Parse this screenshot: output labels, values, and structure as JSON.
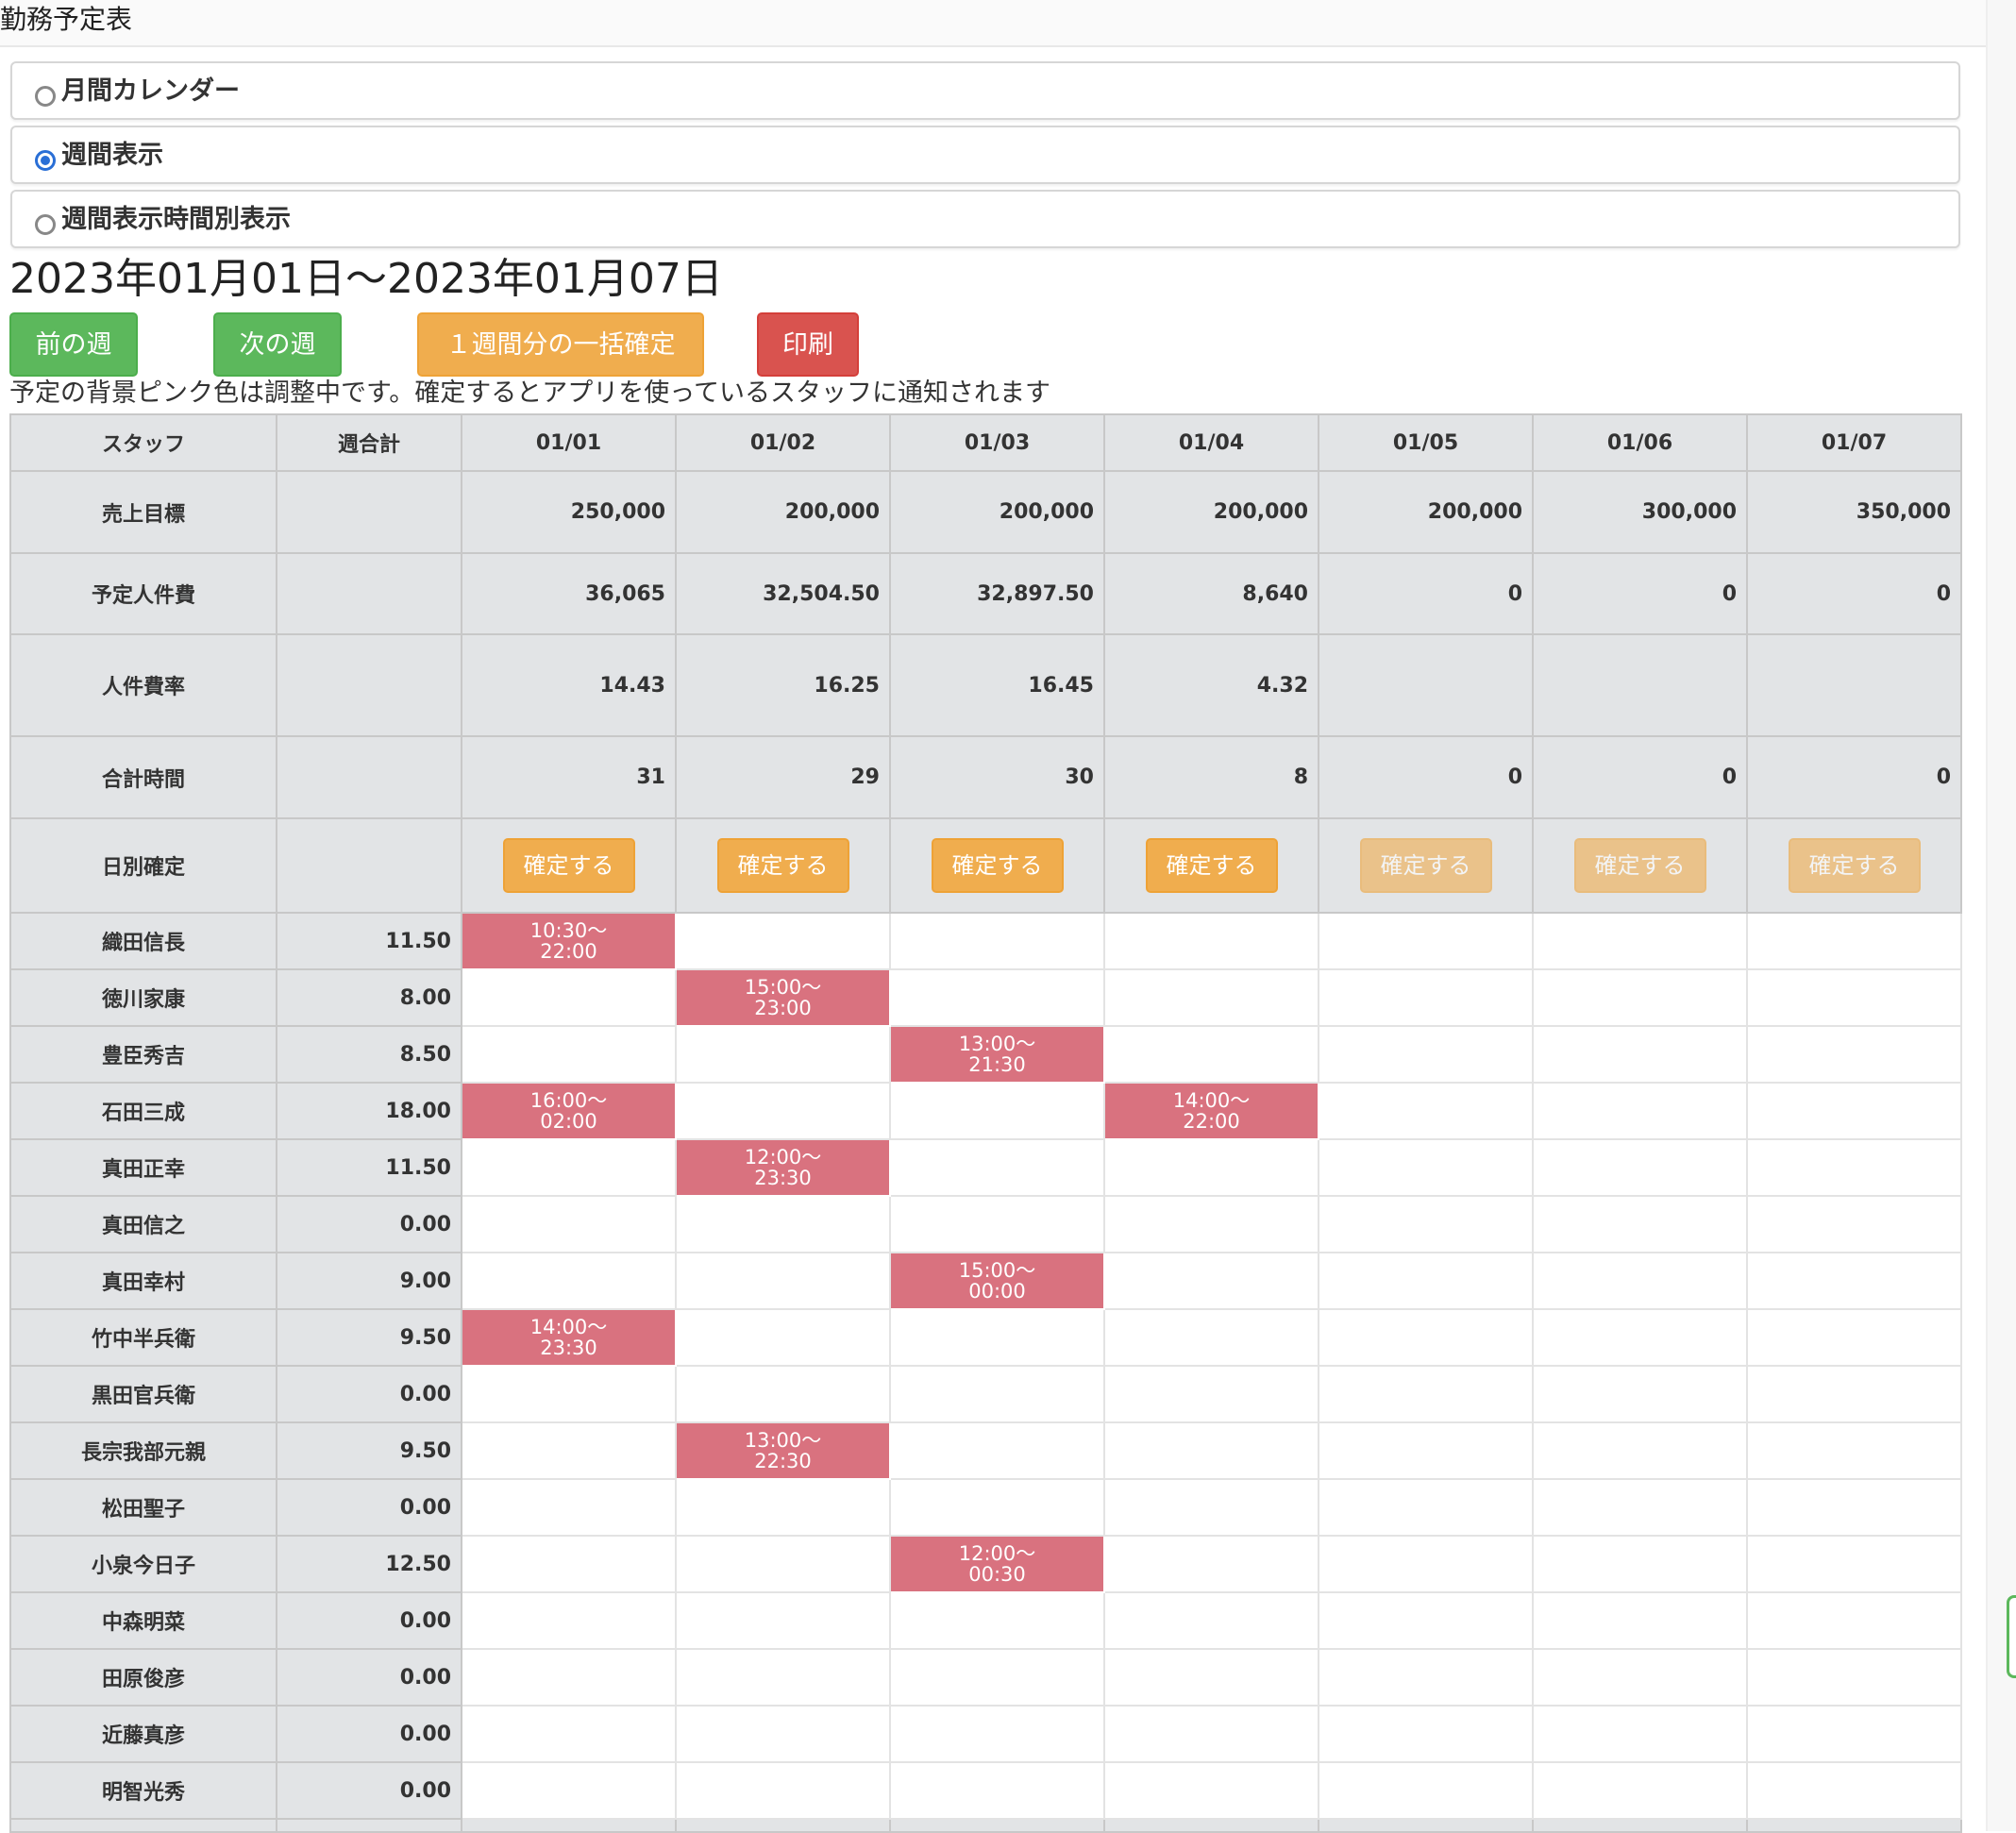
{
  "page_title": "勤務予定表",
  "view_options": [
    {
      "label": "月間カレンダー",
      "checked": false
    },
    {
      "label": "週間表示",
      "checked": true
    },
    {
      "label": "週間表示時間別表示",
      "checked": false
    }
  ],
  "date_range": "2023年01月01日～2023年01月07日",
  "buttons": {
    "prev_week": "前の週",
    "next_week": "次の週",
    "bulk_confirm": "１週間分の一括確定",
    "print": "印刷"
  },
  "note": "予定の背景ピンク色は調整中です。確定するとアプリを使っているスタッフに通知されます",
  "table": {
    "header": {
      "staff": "スタッフ",
      "weekly_total": "週合計",
      "days": [
        "01/01",
        "01/02",
        "01/03",
        "01/04",
        "01/05",
        "01/06",
        "01/07"
      ]
    },
    "summary_rows": [
      {
        "label": "売上目標",
        "values": [
          "250,000",
          "200,000",
          "200,000",
          "200,000",
          "200,000",
          "300,000",
          "350,000"
        ]
      },
      {
        "label": "予定人件費",
        "values": [
          "36,065",
          "32,504.50",
          "32,897.50",
          "8,640",
          "0",
          "0",
          "0"
        ]
      },
      {
        "label": "人件費率",
        "values": [
          "14.43",
          "16.25",
          "16.45",
          "4.32",
          "",
          "",
          ""
        ]
      },
      {
        "label": "合計時間",
        "values": [
          "31",
          "29",
          "30",
          "8",
          "0",
          "0",
          "0"
        ]
      }
    ],
    "confirm_row": {
      "label": "日別確定",
      "button_label": "確定する",
      "enabled": [
        true,
        true,
        true,
        true,
        false,
        false,
        false
      ]
    },
    "staff_rows": [
      {
        "name": "織田信長",
        "total": "11.50",
        "shifts": [
          {
            "start": "10:30～",
            "end": "22:00"
          },
          null,
          null,
          null,
          null,
          null,
          null
        ]
      },
      {
        "name": "徳川家康",
        "total": "8.00",
        "shifts": [
          null,
          {
            "start": "15:00～",
            "end": "23:00"
          },
          null,
          null,
          null,
          null,
          null
        ]
      },
      {
        "name": "豊臣秀吉",
        "total": "8.50",
        "shifts": [
          null,
          null,
          {
            "start": "13:00～",
            "end": "21:30"
          },
          null,
          null,
          null,
          null
        ]
      },
      {
        "name": "石田三成",
        "total": "18.00",
        "shifts": [
          {
            "start": "16:00～",
            "end": "02:00"
          },
          null,
          null,
          {
            "start": "14:00～",
            "end": "22:00"
          },
          null,
          null,
          null
        ]
      },
      {
        "name": "真田正幸",
        "total": "11.50",
        "shifts": [
          null,
          {
            "start": "12:00～",
            "end": "23:30"
          },
          null,
          null,
          null,
          null,
          null
        ]
      },
      {
        "name": "真田信之",
        "total": "0.00",
        "shifts": [
          null,
          null,
          null,
          null,
          null,
          null,
          null
        ]
      },
      {
        "name": "真田幸村",
        "total": "9.00",
        "shifts": [
          null,
          null,
          {
            "start": "15:00～",
            "end": "00:00"
          },
          null,
          null,
          null,
          null
        ]
      },
      {
        "name": "竹中半兵衛",
        "total": "9.50",
        "shifts": [
          {
            "start": "14:00～",
            "end": "23:30"
          },
          null,
          null,
          null,
          null,
          null,
          null
        ]
      },
      {
        "name": "黒田官兵衛",
        "total": "0.00",
        "shifts": [
          null,
          null,
          null,
          null,
          null,
          null,
          null
        ]
      },
      {
        "name": "長宗我部元親",
        "total": "9.50",
        "shifts": [
          null,
          {
            "start": "13:00～",
            "end": "22:30"
          },
          null,
          null,
          null,
          null,
          null
        ]
      },
      {
        "name": "松田聖子",
        "total": "0.00",
        "shifts": [
          null,
          null,
          null,
          null,
          null,
          null,
          null
        ]
      },
      {
        "name": "小泉今日子",
        "total": "12.50",
        "shifts": [
          null,
          null,
          {
            "start": "12:00～",
            "end": "00:30"
          },
          null,
          null,
          null,
          null
        ]
      },
      {
        "name": "中森明菜",
        "total": "0.00",
        "shifts": [
          null,
          null,
          null,
          null,
          null,
          null,
          null
        ]
      },
      {
        "name": "田原俊彦",
        "total": "0.00",
        "shifts": [
          null,
          null,
          null,
          null,
          null,
          null,
          null
        ]
      },
      {
        "name": "近藤真彦",
        "total": "0.00",
        "shifts": [
          null,
          null,
          null,
          null,
          null,
          null,
          null
        ]
      },
      {
        "name": "明智光秀",
        "total": "0.00",
        "shifts": [
          null,
          null,
          null,
          null,
          null,
          null,
          null
        ]
      }
    ]
  },
  "colors": {
    "pending_shift": "#d9727f",
    "green_button": "#5cb85c",
    "orange_button": "#f0ad4e",
    "red_button": "#d9534f",
    "header_gray": "#e2e4e6"
  }
}
